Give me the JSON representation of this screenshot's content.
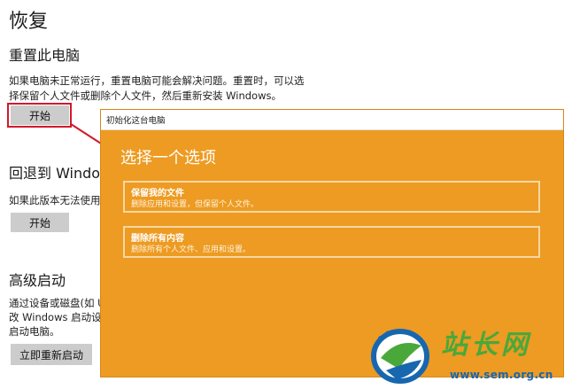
{
  "settings": {
    "page_title": "恢复",
    "reset": {
      "heading": "重置此电脑",
      "desc_line1": "如果电脑未正常运行，重置电脑可能会解决问题。重置时，可以选",
      "desc_line2": "择保留个人文件或删除个人文件，然后重新安装 Windows。",
      "button": "开始"
    },
    "goback": {
      "heading": "回退到 Window",
      "desc": "如果此版本无法使用",
      "button": "开始"
    },
    "advanced": {
      "heading": "高级启动",
      "desc_line1": "通过设备或磁盘(如 U",
      "desc_line2": "改 Windows 启动设置",
      "desc_line3": "启动电脑。",
      "button": "立即重新启动"
    }
  },
  "dialog": {
    "title": "初始化这台电脑",
    "heading": "选择一个选项",
    "options": [
      {
        "title": "保留我的文件",
        "desc": "删除应用和设置，但保留个人文件。"
      },
      {
        "title": "删除所有内容",
        "desc": "删除所有个人文件、应用和设置。"
      }
    ]
  },
  "watermark": {
    "brand_text": "站长网",
    "url": "www.sem.org.cn",
    "colors": {
      "green": "#4aa83a",
      "blue": "#1767b0"
    }
  },
  "colors": {
    "highlight": "#d1192a",
    "dialog_bg": "#ed9b22",
    "button_bg": "#cccccc"
  }
}
